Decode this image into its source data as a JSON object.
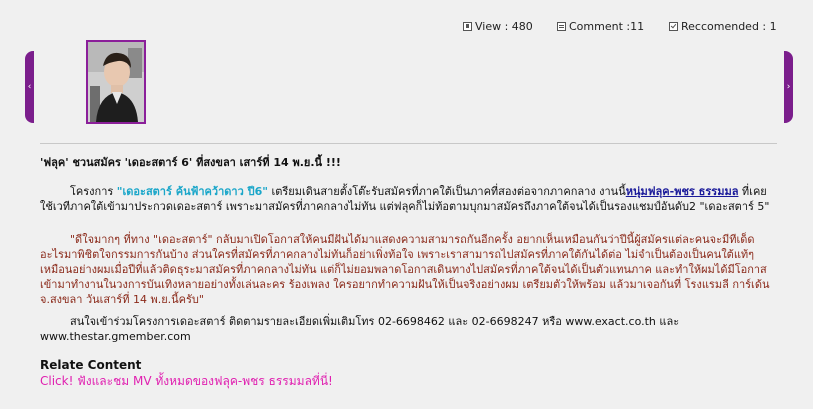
{
  "stats": {
    "view_label": "View : 480",
    "comment_label": "Comment :11",
    "recommended_label": "Reccomended :  1"
  },
  "nav": {
    "prev_glyph": "‹",
    "next_glyph": "›"
  },
  "article": {
    "headline": "'ฟลุค' ชวนสมัคร 'เดอะสตาร์ 6' ที่สงขลา เสาร์ที่ 14 พ.ย.นี้ !!!",
    "p1_before": "โครงการ ",
    "p1_highlight": "\"เดอะสตาร์ ค้นฟ้าคว้าดาว ปี6\"",
    "p1_middle": " เตรียมเดินสายตั้งโต๊ะรับสมัครที่ภาคใต้เป็นภาคที่สองต่อจากภาคกลาง  งานนี้",
    "p1_link": "หนุ่มฟลุค-พชร  ธรรมมล",
    "p1_after": " ที่เคยใช้เวทีภาคใต้เข้ามาประกวดเดอะสตาร์  เพราะมาสมัครที่ภาคกลางไม่ทัน  แต่ฟลุคก็ไม่ท้อตามบุกมาสมัครถึงภาคใต้จนได้เป็นรองแชมป์อันดับ2 \"เดอะสตาร์ 5\"",
    "p2": "\"ดีใจมากๆ ที่ทาง  \"เดอะสตาร์\" กลับมาเปิดโอกาสให้คนมีฝันได้มาแสดงความสามารถกันอีกครั้ง  อยากเห็นเหมือนกันว่าปีนี้ผู้สมัครแต่ละคนจะมีทีเด็ดอะไรมาพิชิตใจกรรมการกันบ้าง  ส่วนใครที่สมัครที่ภาคกลางไม่ทันก็อย่าเพิ่งท้อใจ  เพราะเราสามารถไปสมัครที่ภาคใต้กันได้ต่อ  ไม่จำเป็นต้องเป็นคนใต้แท้ๆ  เหมือนอย่างผมเมื่อปีที่แล้วติดธุระมาสมัครที่ภาคกลางไม่ทัน  แต่ก็ไม่ยอมพลาดโอกาสเดินทางไปสมัครที่ภาคใต้จนได้เป็นตัวแทนภาค  และทำให้ผมได้มีโอกาสเข้ามาทำงานในวงการบันเทิงหลายอย่างทั้งเล่นละคร  ร้องเพลง  ใครอยากทำความฝันให้เป็นจริงอย่างผม  เตรียมตัวให้พร้อม  แล้วมาเจอกันที่ โรงแรมลี การ์เด้น จ.สงขลา วันเสาร์ที่ 14 พ.ย.นี้ครับ\"",
    "p3": "สนใจเข้าร่วมโครงการเดอะสตาร์  ติดตามรายละเอียดเพิ่มเติมโทร  02-6698462 และ 02-6698247 หรือ www.exact.co.th และ www.thestar.gmember.com"
  },
  "related": {
    "title": "Relate Content",
    "link": "Click! ฟังและชม MV ทั้งหมดของฟลุค-พชร  ธรรมมลที่นี่!"
  },
  "colors": {
    "accent_purple": "#7b1e8c",
    "highlight_cyan": "#1aa6c9",
    "quote_red": "#8b2a1a",
    "related_link_pink": "#e020b0"
  },
  "icons": [
    "view-icon",
    "comment-icon",
    "recommend-icon",
    "chevron-left-icon",
    "chevron-right-icon"
  ]
}
